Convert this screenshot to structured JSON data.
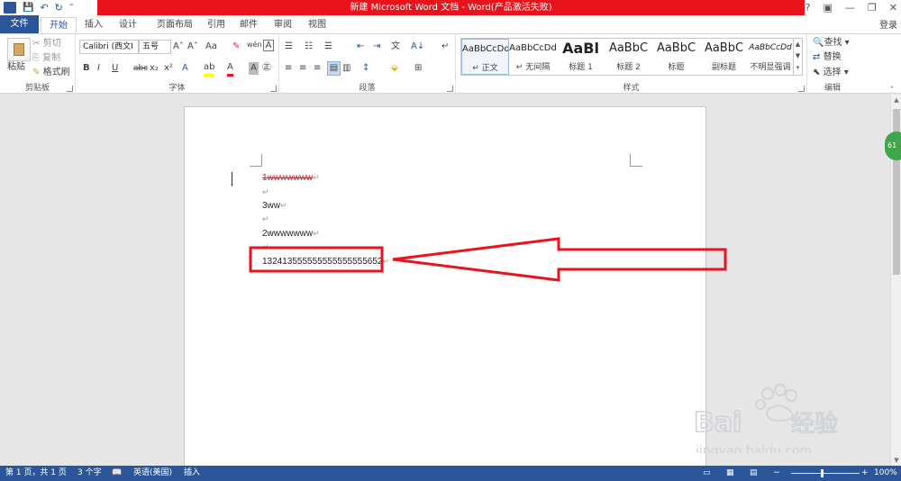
{
  "window": {
    "title": "新建 Microsoft Word 文档 - Word(产品激活失败)",
    "controls": [
      "?",
      "▣",
      "—",
      "❐",
      "✕"
    ]
  },
  "qat": {
    "logo": "W",
    "save": "💾",
    "undo": "↶",
    "redo": "↻",
    "more": "⁼"
  },
  "tabs": {
    "file": "文件",
    "home": "开始",
    "insert": "插入",
    "design": "设计",
    "layout": "页面布局",
    "references": "引用",
    "mailings": "邮件",
    "review": "审阅",
    "view": "视图",
    "login": "登录"
  },
  "clipboard": {
    "paste": "粘贴",
    "cut": "剪切",
    "copy": "复制",
    "format_painter": "格式刷",
    "label": "剪贴板"
  },
  "font": {
    "name": "Calibri (西文I",
    "size": "五号",
    "grow": "A˄",
    "shrink": "A˅",
    "case": "Aa",
    "clear": "✎",
    "phonetic": "wén",
    "border": "A",
    "bold": "B",
    "italic": "I",
    "underline": "U",
    "strike": "abc",
    "sub": "x₂",
    "sup": "x²",
    "effects": "A",
    "highlight": "ab",
    "color": "A",
    "shade": "A",
    "enclose": "㊣",
    "label": "字体"
  },
  "paragraph": {
    "label": "段落",
    "row1": [
      "☰",
      "☷",
      "☰",
      "⇤",
      "⇥",
      "文",
      "A↓",
      "↵"
    ],
    "row2": [
      "≡",
      "≡",
      "≡",
      "▤",
      "▥",
      "↕",
      "⬙",
      "⊞"
    ]
  },
  "styles": {
    "label": "样式",
    "items": [
      {
        "sample": "AaBbCcDd",
        "name": "↵ 正文"
      },
      {
        "sample": "AaBbCcDd",
        "name": "↵ 无间隔"
      },
      {
        "sample": "AaBl",
        "name": "标题 1"
      },
      {
        "sample": "AaBbC",
        "name": "标题 2"
      },
      {
        "sample": "AaBbC",
        "name": "标题"
      },
      {
        "sample": "AaBbC",
        "name": "副标题"
      },
      {
        "sample": "AaBbCcDd",
        "name": "不明显强调"
      }
    ]
  },
  "editing": {
    "find": "查找",
    "replace": "替换",
    "select": "选择",
    "label": "编辑"
  },
  "document": {
    "lines": [
      {
        "text": "1wwwwwww",
        "style": "strike"
      },
      {
        "text": "",
        "style": "empty"
      },
      {
        "text": "3ww",
        "style": "normal"
      },
      {
        "text": "",
        "style": "empty"
      },
      {
        "text": "2wwwwwww",
        "style": "normal"
      },
      {
        "text": "",
        "style": "empty"
      },
      {
        "text": "132413555555555555555652",
        "style": "highlight"
      }
    ],
    "para_mark": "↵"
  },
  "sidebar_badge": "61",
  "status": {
    "page": "第 1 页，共 1 页",
    "words": "3 个字",
    "proof_icon": "📖",
    "language": "英语(美国)",
    "mode": "插入",
    "zoom": "100%",
    "zoom_minus": "−",
    "zoom_plus": "+"
  },
  "colors": {
    "accent": "#2b579a",
    "title_red": "#e8131b",
    "annotation_red": "#e8131b"
  }
}
